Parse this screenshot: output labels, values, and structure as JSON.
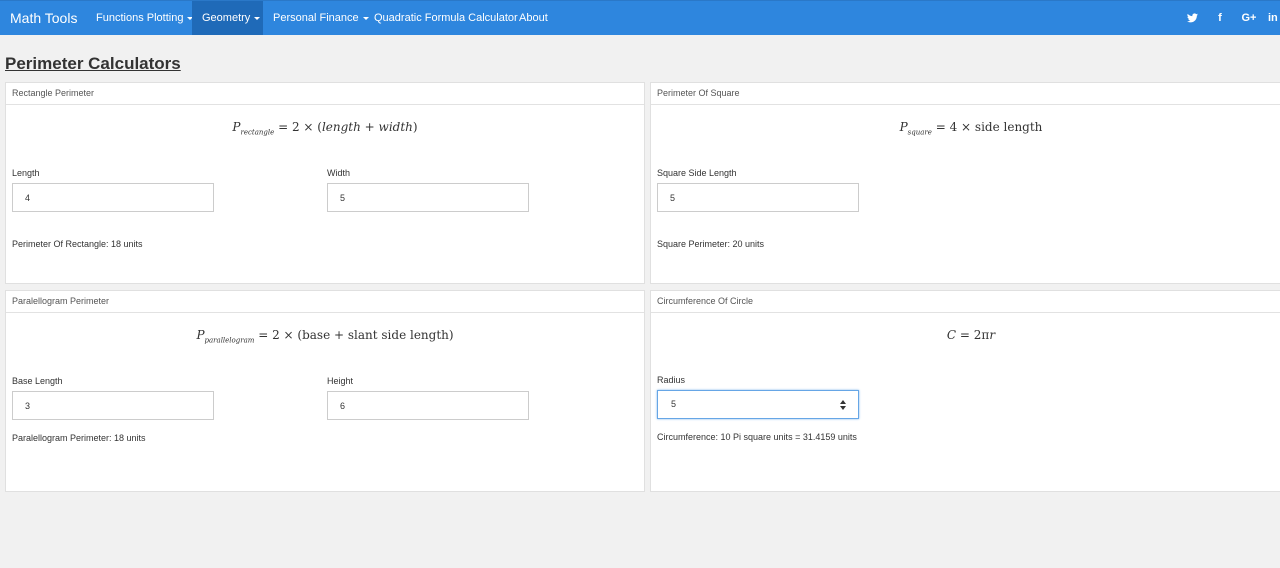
{
  "navbar": {
    "brand": "Math Tools",
    "items": [
      {
        "label": "Functions Plotting",
        "dropdown": true
      },
      {
        "label": "Geometry",
        "dropdown": true,
        "active": true
      },
      {
        "label": "Personal Finance",
        "dropdown": true
      },
      {
        "label": "Quadratic Formula Calculator"
      },
      {
        "label": "About"
      }
    ],
    "social": [
      {
        "icon": "twitter-icon"
      },
      {
        "icon": "facebook-icon",
        "text": "f"
      },
      {
        "icon": "google-plus-icon",
        "text": "G+"
      },
      {
        "icon": "linkedin-icon",
        "text": "in"
      }
    ]
  },
  "page_title": "Perimeter Calculators",
  "cards": {
    "rectangle": {
      "title": "Rectangle Perimeter",
      "formula": {
        "lhs": "P",
        "sub": "rectangle",
        "rhs_start": " = 2 × (",
        "var1": "length",
        "plus": " + ",
        "var2": "width",
        "rhs_end": ")"
      },
      "fields": [
        {
          "label": "Length",
          "value": "4"
        },
        {
          "label": "Width",
          "value": "5"
        }
      ],
      "result": "Perimeter Of Rectangle: 18 units"
    },
    "square": {
      "title": "Perimeter Of Square",
      "formula": {
        "lhs": "P",
        "sub": "square",
        "rhs": " = 4 × side length"
      },
      "fields": [
        {
          "label": "Square Side Length",
          "value": "5"
        }
      ],
      "result": "Square Perimeter: 20 units"
    },
    "parallelogram": {
      "title": "Paralellogram Perimeter",
      "formula": {
        "lhs": "P",
        "sub": "parallelogram",
        "rhs": " = 2 × (base + slant side length)"
      },
      "fields": [
        {
          "label": "Base Length",
          "value": "3"
        },
        {
          "label": "Height",
          "value": "6"
        }
      ],
      "result": "Paralellogram Perimeter: 18 units"
    },
    "circle": {
      "title": "Circumference Of Circle",
      "formula": {
        "lhs": "C",
        "rhs": " = 2π",
        "var": "r"
      },
      "fields": [
        {
          "label": "Radius",
          "value": "5"
        }
      ],
      "result": "Circumference: 10 Pi square units = 31.4159 units"
    }
  }
}
